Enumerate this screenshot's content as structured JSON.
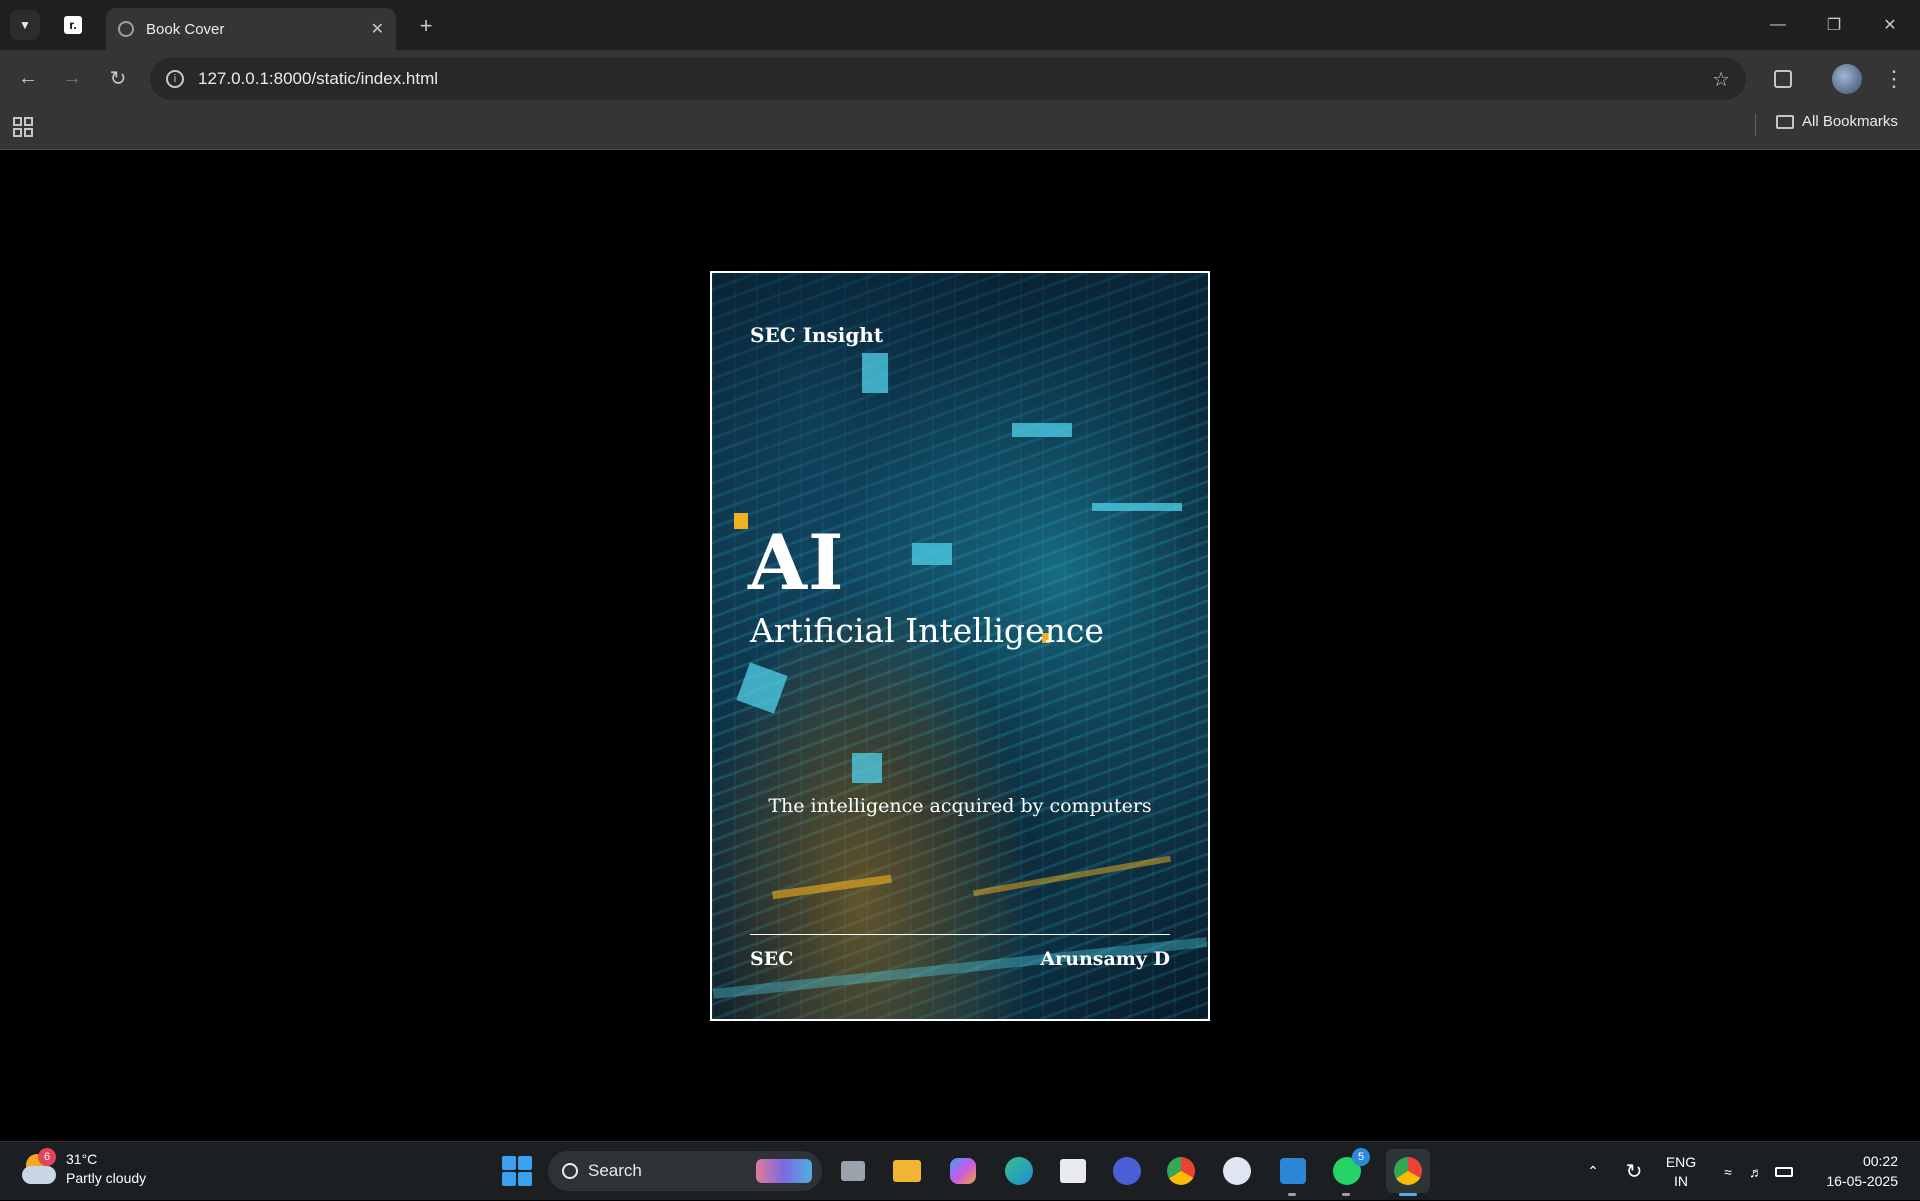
{
  "browser": {
    "tab_title": "Book Cover",
    "new_tab_symbol": "+",
    "url": "127.0.0.1:8000/static/index.html",
    "all_bookmarks_label": "All Bookmarks"
  },
  "cover": {
    "series": "SEC Insight",
    "short_title": "AI",
    "title": "Artificial Intelligence",
    "tagline": "The intelligence acquired by computers",
    "publisher": "SEC",
    "author": "Arunsamy D"
  },
  "taskbar": {
    "weather_temp": "31°C",
    "weather_desc": "Partly cloudy",
    "weather_badge": "6",
    "search_label": "Search",
    "whatsapp_badge": "5",
    "lang_primary": "ENG",
    "lang_secondary": "IN",
    "time": "00:22",
    "date": "16-05-2025"
  },
  "colors": {
    "browser_frame": "#1f1f1f",
    "toolbar": "#353535",
    "page_background": "#000000",
    "cover_border": "#ffffff",
    "accent_orange": "#f0b020",
    "accent_cyan": "#50d2eb",
    "taskbar": "#1c1f22"
  }
}
